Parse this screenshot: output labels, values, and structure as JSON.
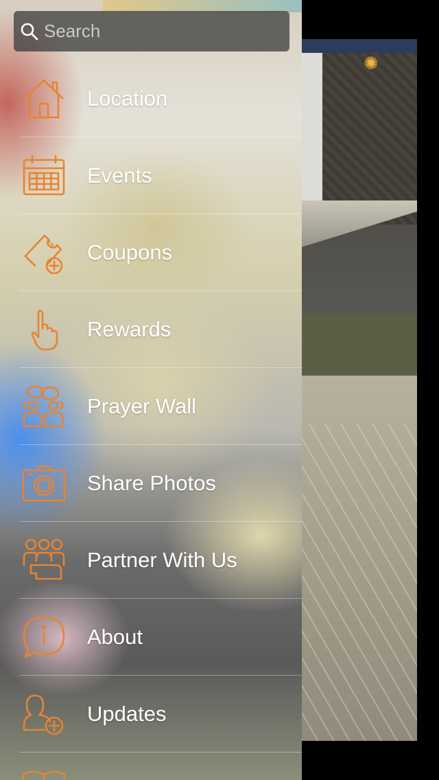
{
  "search": {
    "placeholder": "Search"
  },
  "menu": {
    "items": [
      {
        "label": "Location",
        "icon": "house-icon"
      },
      {
        "label": "Events",
        "icon": "calendar-icon"
      },
      {
        "label": "Coupons",
        "icon": "coupon-icon"
      },
      {
        "label": "Rewards",
        "icon": "pointing-hand-icon"
      },
      {
        "label": "Prayer Wall",
        "icon": "people-chat-icon"
      },
      {
        "label": "Share Photos",
        "icon": "camera-icon"
      },
      {
        "label": "Partner With Us",
        "icon": "group-icon"
      },
      {
        "label": "About",
        "icon": "info-bubble-icon"
      },
      {
        "label": "Updates",
        "icon": "add-user-icon"
      }
    ]
  },
  "colors": {
    "icon_accent": "#e98330",
    "label_text": "#ffffff"
  }
}
